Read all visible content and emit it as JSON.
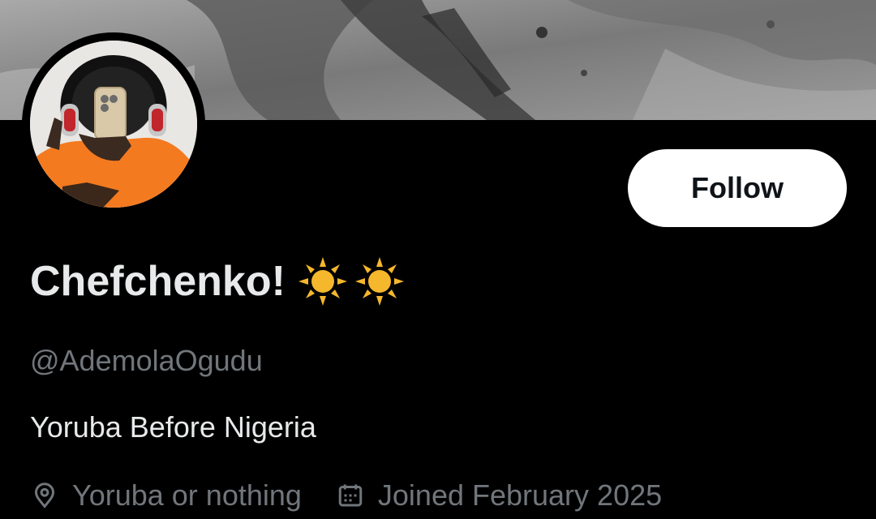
{
  "profile": {
    "display_name": "Chefchenko!",
    "name_emojis": [
      "sun-icon",
      "sun-icon"
    ],
    "handle": "@AdemolaOgudu",
    "bio": "Yoruba Before Nigeria",
    "location": "Yoruba or nothing",
    "joined": "Joined February 2025"
  },
  "actions": {
    "follow_label": "Follow"
  },
  "colors": {
    "background": "#000000",
    "primary_text": "#e7e9ea",
    "secondary_text": "#71767b",
    "follow_bg": "#ffffff",
    "follow_text": "#0f1419",
    "sun": "#f5b72b",
    "avatar_hoodie": "#f47a1f"
  },
  "icons": {
    "location": "map-pin-icon",
    "joined": "calendar-icon"
  }
}
